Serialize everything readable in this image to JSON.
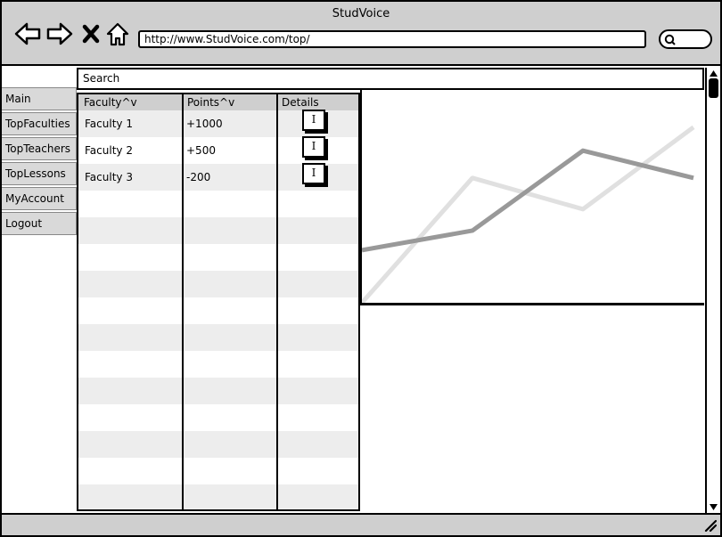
{
  "window": {
    "title": "StudVoice"
  },
  "browser": {
    "url": "http://www.StudVoice.com/top/",
    "icons": {
      "back": "arrow-left-icon",
      "forward": "arrow-right-icon",
      "stop": "close-icon",
      "home": "home-icon",
      "search": "search-icon"
    }
  },
  "search": {
    "label": "Search"
  },
  "sidebar": {
    "items": [
      {
        "label": "Main"
      },
      {
        "label": "TopFaculties"
      },
      {
        "label": "TopTeachers"
      },
      {
        "label": "TopLessons"
      },
      {
        "label": "MyAccount"
      },
      {
        "label": "Logout"
      }
    ]
  },
  "table": {
    "columns": [
      "Faculty^v",
      "Points^v",
      "Details"
    ],
    "rows": [
      {
        "faculty": "Faculty 1",
        "points": "+1000",
        "details": "I"
      },
      {
        "faculty": "Faculty 2",
        "points": "+500",
        "details": "I"
      },
      {
        "faculty": "Faculty 3",
        "points": "-200",
        "details": "I"
      }
    ]
  },
  "chart_data": {
    "type": "line",
    "x": [
      0,
      1,
      2,
      3
    ],
    "ylim": [
      0,
      100
    ],
    "series": [
      {
        "values": [
          27,
          37,
          78,
          64
        ],
        "color": "#999999"
      },
      {
        "values": [
          0,
          64,
          48,
          90
        ],
        "color": "#e0e0e0"
      }
    ]
  },
  "colors": {
    "chrome": "#cfcfcf",
    "stripe": "#ededed",
    "nav": "#d9d9d9"
  }
}
